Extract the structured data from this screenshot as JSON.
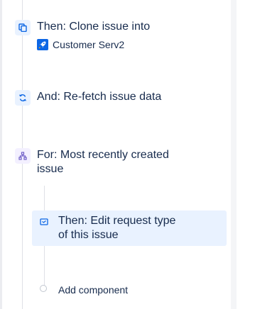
{
  "steps": [
    {
      "icon": "clone-icon",
      "text": "Then: Clone issue into",
      "project": {
        "icon": "rocket-icon",
        "name": "Customer Serv2"
      }
    },
    {
      "icon": "refresh-icon",
      "text": "And: Re-fetch issue data"
    },
    {
      "icon": "branch-icon",
      "line1": "For: Most recently created",
      "line2": "issue",
      "nested": {
        "icon": "request-type-icon",
        "line1": "Then: Edit request type",
        "line2": "of this issue"
      },
      "add_component": "Add component"
    }
  ],
  "colors": {
    "accent": "#0C66E4",
    "card_bg": "#E9F2FF",
    "branch": "#6E5DC6",
    "text": "#172B4D"
  }
}
